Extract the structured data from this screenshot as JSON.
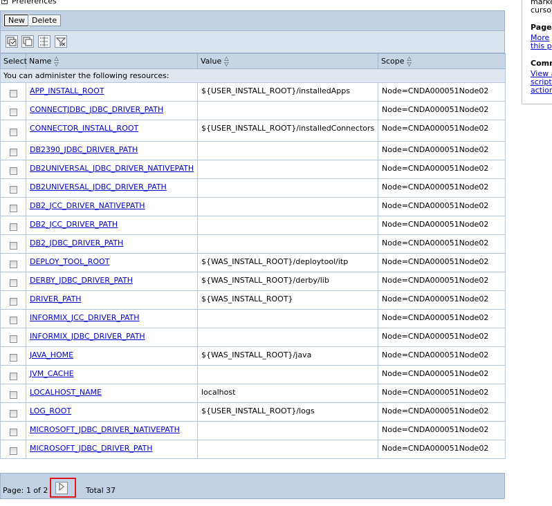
{
  "preferences": {
    "label": "Preferences",
    "toggle": "+"
  },
  "toolbar": {
    "new_label": "New",
    "delete_label": "Delete"
  },
  "icon_toolbar": {
    "icons": [
      "select-all-icon",
      "deselect-all-icon",
      "show-filter-icon",
      "clear-filter-icon"
    ]
  },
  "table": {
    "headers": {
      "select": "Select",
      "name": "Name",
      "value": "Value",
      "scope": "Scope"
    },
    "info_text": "You can administer the following resources:",
    "rows": [
      {
        "name": "APP_INSTALL_ROOT",
        "value": "${USER_INSTALL_ROOT}/installedApps",
        "scope": "Node=CNDA000051Node02"
      },
      {
        "name": "CONNECTJDBC_JDBC_DRIVER_PATH",
        "value": "",
        "scope": "Node=CNDA000051Node02"
      },
      {
        "name": "CONNECTOR_INSTALL_ROOT",
        "value": "${USER_INSTALL_ROOT}/installedConnectors",
        "scope": "Node=CNDA000051Node02"
      },
      {
        "name": "DB2390_JDBC_DRIVER_PATH",
        "value": "",
        "scope": "Node=CNDA000051Node02"
      },
      {
        "name": "DB2UNIVERSAL_JDBC_DRIVER_NATIVEPATH",
        "value": "",
        "scope": "Node=CNDA000051Node02"
      },
      {
        "name": "DB2UNIVERSAL_JDBC_DRIVER_PATH",
        "value": "",
        "scope": "Node=CNDA000051Node02"
      },
      {
        "name": "DB2_JCC_DRIVER_NATIVEPATH",
        "value": "",
        "scope": "Node=CNDA000051Node02"
      },
      {
        "name": "DB2_JCC_DRIVER_PATH",
        "value": "",
        "scope": "Node=CNDA000051Node02"
      },
      {
        "name": "DB2_JDBC_DRIVER_PATH",
        "value": "",
        "scope": "Node=CNDA000051Node02"
      },
      {
        "name": "DEPLOY_TOOL_ROOT",
        "value": "${WAS_INSTALL_ROOT}/deploytool/itp",
        "scope": "Node=CNDA000051Node02"
      },
      {
        "name": "DERBY_JDBC_DRIVER_PATH",
        "value": "${WAS_INSTALL_ROOT}/derby/lib",
        "scope": "Node=CNDA000051Node02"
      },
      {
        "name": "DRIVER_PATH",
        "value": "${WAS_INSTALL_ROOT}",
        "scope": "Node=CNDA000051Node02"
      },
      {
        "name": "INFORMIX_JCC_DRIVER_PATH",
        "value": "",
        "scope": "Node=CNDA000051Node02"
      },
      {
        "name": "INFORMIX_JDBC_DRIVER_PATH",
        "value": "",
        "scope": "Node=CNDA000051Node02"
      },
      {
        "name": "JAVA_HOME",
        "value": "${WAS_INSTALL_ROOT}/java",
        "scope": "Node=CNDA000051Node02"
      },
      {
        "name": "JVM_CACHE",
        "value": "",
        "scope": "Node=CNDA000051Node02"
      },
      {
        "name": "LOCALHOST_NAME",
        "value": "localhost",
        "scope": "Node=CNDA000051Node02"
      },
      {
        "name": "LOG_ROOT",
        "value": "${USER_INSTALL_ROOT}/logs",
        "scope": "Node=CNDA000051Node02"
      },
      {
        "name": "MICROSOFT_JDBC_DRIVER_NATIVEPATH",
        "value": "",
        "scope": "Node=CNDA000051Node02"
      },
      {
        "name": "MICROSOFT_JDBC_DRIVER_PATH",
        "value": "",
        "scope": "Node=CNDA000051Node02"
      }
    ]
  },
  "pagination": {
    "page_text": "Page: 1 of 2",
    "total_text": "Total 37",
    "next_icon": "next-page-icon"
  },
  "side_panel": {
    "line1": "marke",
    "line2": "curso",
    "page_heading": "Page",
    "page_link1": "More",
    "page_link2": "this p",
    "command_heading": "Comm",
    "command_link1": "View a",
    "command_link2": "scripti",
    "command_link3": "action"
  }
}
